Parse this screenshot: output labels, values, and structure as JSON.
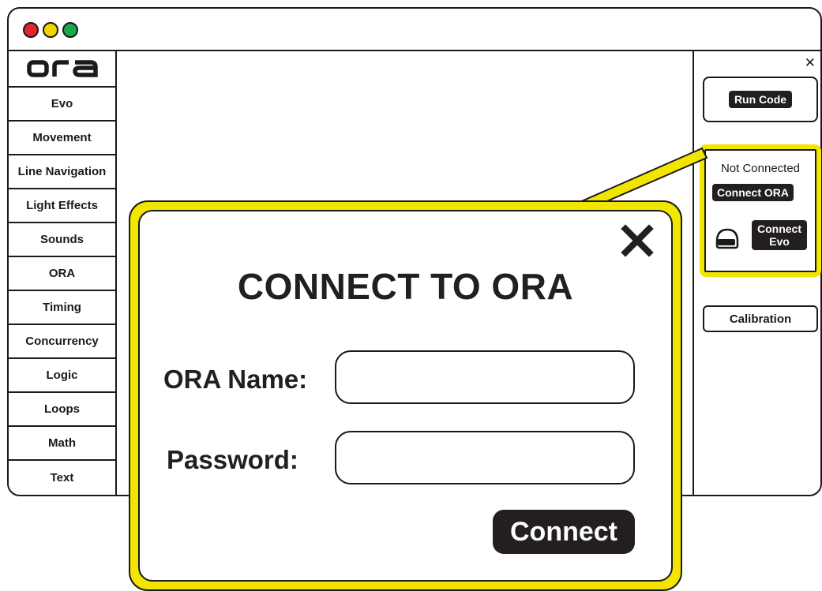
{
  "window": {
    "traffic_lights": {
      "close": "#e1262c",
      "minimize": "#f2d500",
      "maximize": "#17a94a"
    }
  },
  "sidebar": {
    "logo_text": "ora",
    "categories": [
      {
        "label": "Evo"
      },
      {
        "label": "Movement"
      },
      {
        "label": "Line Navigation"
      },
      {
        "label": "Light Effects"
      },
      {
        "label": "Sounds"
      },
      {
        "label": "ORA"
      },
      {
        "label": "Timing"
      },
      {
        "label": "Concurrency"
      },
      {
        "label": "Logic"
      },
      {
        "label": "Loops"
      },
      {
        "label": "Math"
      },
      {
        "label": "Text"
      }
    ]
  },
  "right_panel": {
    "close_icon": "close-icon",
    "run_code_label": "Run Code",
    "connection": {
      "status_text": "Not Connected",
      "connect_ora_label": "Connect ORA",
      "helmet_icon": "helmet-icon",
      "connect_evo_label": "Connect Evo"
    },
    "calibration_label": "Calibration"
  },
  "modal": {
    "title": "CONNECT TO ORA",
    "close_icon": "close-icon",
    "fields": [
      {
        "label": "ORA Name:",
        "value": "",
        "placeholder": ""
      },
      {
        "label": "Password:",
        "value": "",
        "placeholder": ""
      }
    ],
    "connect_label": "Connect"
  },
  "colors": {
    "highlight": "#f2e600",
    "button_dark": "#231f20",
    "outline": "#1a1a1a"
  }
}
